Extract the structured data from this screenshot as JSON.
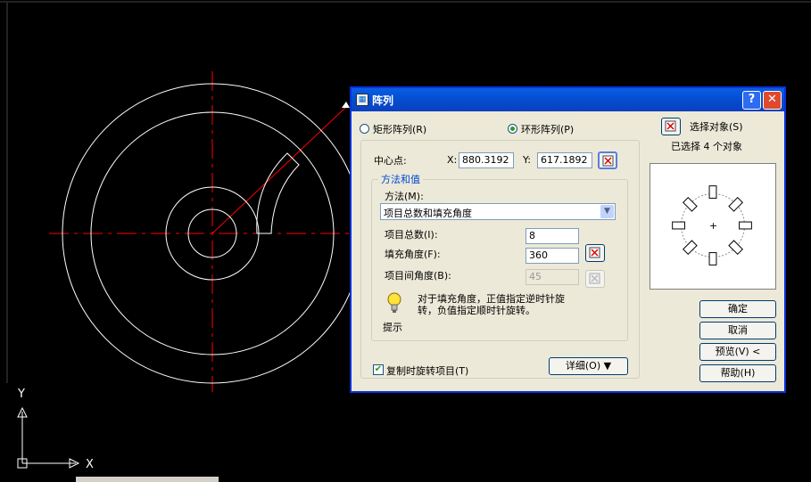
{
  "dialog": {
    "title": "阵列",
    "help_glyph": "?",
    "close_glyph": "✕",
    "rect_array_label": "矩形阵列(R)",
    "polar_array_label": "环形阵列(P)",
    "select_objects_label": "选择对象(S)",
    "selected_count_label": "已选择 4 个对象",
    "center_label": "中心点:",
    "x_label": "X:",
    "x_value": "880.3192",
    "y_label": "Y:",
    "y_value": "617.1892",
    "method_group_title": "方法和值",
    "method_label": "方法(M):",
    "method_value": "项目总数和填充角度",
    "total_items_label": "项目总数(I):",
    "total_items_value": "8",
    "fill_angle_label": "填充角度(F):",
    "fill_angle_value": "360",
    "item_angle_label": "项目间角度(B):",
    "item_angle_value": "45",
    "tip_text": "对于填充角度，正值指定逆时针旋转，负值指定顺时针旋转。",
    "tip_label": "提示",
    "rotate_items_label": "复制时旋转项目(T)",
    "details_label": "详细(O) ▼",
    "ok_label": "确定",
    "cancel_label": "取消",
    "preview_label": "预览(V) <",
    "help_label": "帮助(H)"
  },
  "axis": {
    "y_label": "Y",
    "x_label": "X"
  },
  "colors": {
    "cad_background": "#000000",
    "cad_lines": "#ffffff",
    "centerline": "#ff0000",
    "dialog_face": "#ece9d8",
    "title_bar": "#0a5ee4"
  }
}
